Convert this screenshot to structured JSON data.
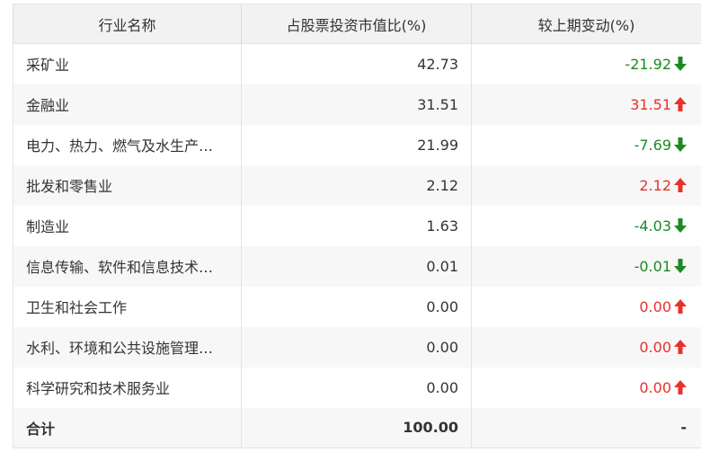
{
  "header": {
    "col_name": "行业名称",
    "col_ratio": "占股票投资市值比(%)",
    "col_change": "较上期变动(%)"
  },
  "colors": {
    "up": "#e8312b",
    "down": "#1a8a22"
  },
  "rows": [
    {
      "name": "采矿业",
      "ratio": "42.73",
      "change": "-21.92",
      "direction": "down",
      "arrow_icon": "arrow-down-icon"
    },
    {
      "name": "金融业",
      "ratio": "31.51",
      "change": "31.51",
      "direction": "up",
      "arrow_icon": "arrow-up-icon"
    },
    {
      "name": "电力、热力、燃气及水生产…",
      "ratio": "21.99",
      "change": "-7.69",
      "direction": "down",
      "arrow_icon": "arrow-down-icon"
    },
    {
      "name": "批发和零售业",
      "ratio": "2.12",
      "change": "2.12",
      "direction": "up",
      "arrow_icon": "arrow-up-icon"
    },
    {
      "name": "制造业",
      "ratio": "1.63",
      "change": "-4.03",
      "direction": "down",
      "arrow_icon": "arrow-down-icon"
    },
    {
      "name": "信息传输、软件和信息技术…",
      "ratio": "0.01",
      "change": "-0.01",
      "direction": "down",
      "arrow_icon": "arrow-down-icon"
    },
    {
      "name": "卫生和社会工作",
      "ratio": "0.00",
      "change": "0.00",
      "direction": "up",
      "arrow_icon": "arrow-up-icon"
    },
    {
      "name": "水利、环境和公共设施管理…",
      "ratio": "0.00",
      "change": "0.00",
      "direction": "up",
      "arrow_icon": "arrow-up-icon"
    },
    {
      "name": "科学研究和技术服务业",
      "ratio": "0.00",
      "change": "0.00",
      "direction": "up",
      "arrow_icon": "arrow-up-icon"
    }
  ],
  "total": {
    "name": "合计",
    "ratio": "100.00",
    "change": "-"
  }
}
